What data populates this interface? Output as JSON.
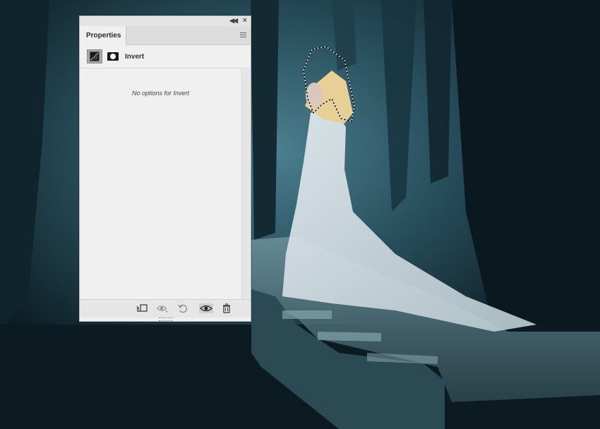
{
  "panel": {
    "tab_label": "Properties",
    "adjustment_title": "Invert",
    "message": "No options for Invert"
  },
  "icons": {
    "collapse": "double-chevron-left-icon",
    "close": "close-icon",
    "menu": "hamburger-menu-icon",
    "adjustment": "adjustment-layer-icon",
    "mask": "layer-mask-icon",
    "clip": "clip-to-layer-icon",
    "view_previous": "view-previous-state-icon",
    "reset": "reset-icon",
    "visibility": "eye-icon",
    "delete": "trash-icon"
  },
  "colors": {
    "panel_bg": "#f0f0f0",
    "scene_dark": "#0d1e26",
    "scene_fog": "#3f6e7c"
  }
}
